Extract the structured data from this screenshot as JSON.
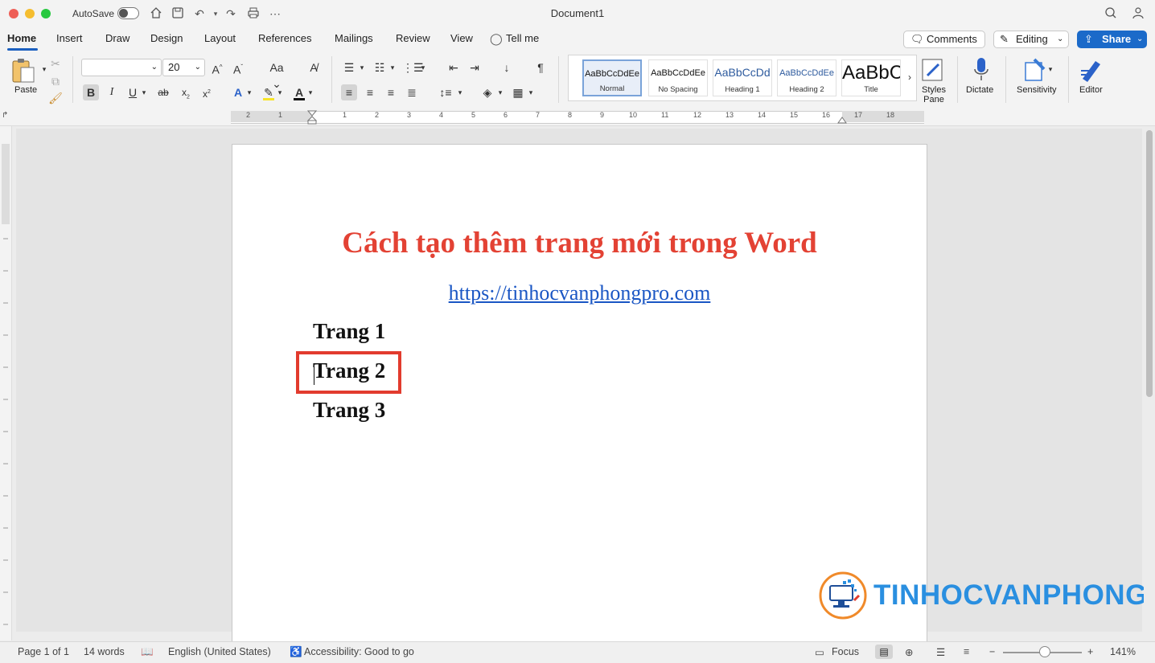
{
  "titlebar": {
    "autosave_label": "AutoSave",
    "document_title": "Document1"
  },
  "tabs": [
    {
      "label": "Home"
    },
    {
      "label": "Insert"
    },
    {
      "label": "Draw"
    },
    {
      "label": "Design"
    },
    {
      "label": "Layout"
    },
    {
      "label": "References"
    },
    {
      "label": "Mailings"
    },
    {
      "label": "Review"
    },
    {
      "label": "View"
    },
    {
      "label": "Tell me"
    }
  ],
  "top_buttons": {
    "comments": "Comments",
    "editing": "Editing",
    "share": "Share"
  },
  "ribbon": {
    "paste_label": "Paste",
    "font_name": "",
    "font_size": "20",
    "styles": [
      {
        "preview": "AaBbCcDdEe",
        "name": "Normal"
      },
      {
        "preview": "AaBbCcDdEe",
        "name": "No Spacing"
      },
      {
        "preview": "AaBbCcDd",
        "name": "Heading 1"
      },
      {
        "preview": "AaBbCcDdEe",
        "name": "Heading 2"
      },
      {
        "preview": "AaBbC",
        "name": "Title"
      }
    ],
    "styles_pane": "Styles Pane",
    "dictate": "Dictate",
    "sensitivity": "Sensitivity",
    "editor": "Editor"
  },
  "ruler": {
    "numbers": [
      "2",
      "1",
      "1",
      "2",
      "3",
      "4",
      "5",
      "6",
      "7",
      "8",
      "9",
      "10",
      "11",
      "12",
      "13",
      "14",
      "15",
      "16",
      "17",
      "18"
    ]
  },
  "document": {
    "heading": "Cách tạo thêm trang mới trong Word",
    "link": "https://tinhocvanphongpro.com",
    "paragraphs": [
      "Trang 1",
      "Trang 2",
      "Trang 3"
    ]
  },
  "watermark": {
    "text": "TINHOCVANPHONG"
  },
  "statusbar": {
    "page": "Page 1 of 1",
    "words": "14 words",
    "language": "English (United States)",
    "accessibility": "Accessibility: Good to go",
    "focus": "Focus",
    "zoom": "141%"
  },
  "colors": {
    "heading": "#e34234",
    "link": "#1a56c4",
    "accent": "#1b6ac9",
    "highlight_box": "#e23b2e",
    "watermark": "#2a8fe0"
  }
}
